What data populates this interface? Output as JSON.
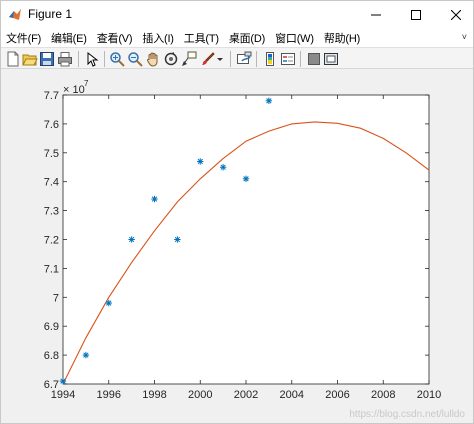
{
  "window": {
    "title": "Figure 1",
    "minimize_glyph": "—",
    "maximize_glyph": "☐",
    "close_glyph": "✕"
  },
  "menu": {
    "items": [
      {
        "label": "文件(F)"
      },
      {
        "label": "编辑(E)"
      },
      {
        "label": "查看(V)"
      },
      {
        "label": "插入(I)"
      },
      {
        "label": "工具(T)"
      },
      {
        "label": "桌面(D)"
      },
      {
        "label": "窗口(W)"
      },
      {
        "label": "帮助(H)"
      }
    ],
    "expand_glyph": "˅"
  },
  "toolbar": {
    "buttons": [
      "new-figure-icon",
      "open-file-icon",
      "save-icon",
      "print-icon",
      "edit-plot-arrow-icon",
      "zoom-in-icon",
      "zoom-out-icon",
      "pan-hand-icon",
      "rotate-3d-icon",
      "data-cursor-icon",
      "brush-icon",
      "brush-dropdown-icon",
      "link-plot-icon",
      "insert-colorbar-icon",
      "insert-legend-icon",
      "hide-plot-tools-icon",
      "show-plot-tools-icon"
    ]
  },
  "colors": {
    "window_bg": "#f0f0f0",
    "axes_bg": "#ffffff",
    "marker": "#0072bd",
    "fit_line": "#d95319",
    "axis": "#262626"
  },
  "watermark": "https://blog.csdn.net/lulldo",
  "chart_data": {
    "type": "scatter",
    "title": "",
    "xlabel": "",
    "ylabel": "",
    "xlim": [
      1994,
      2010
    ],
    "ylim": [
      6.7,
      7.7
    ],
    "y_exponent_label": "× 10",
    "y_exponent_power": "7",
    "xticks": [
      1994,
      1996,
      1998,
      2000,
      2002,
      2004,
      2006,
      2008,
      2010
    ],
    "yticks": [
      6.7,
      6.8,
      6.9,
      7.0,
      7.1,
      7.2,
      7.3,
      7.4,
      7.5,
      7.6,
      7.7
    ],
    "xtick_labels": [
      "1994",
      "1996",
      "1998",
      "2000",
      "2002",
      "2004",
      "2006",
      "2008",
      "2010"
    ],
    "ytick_labels": [
      "6.7",
      "6.8",
      "6.9",
      "7",
      "7.1",
      "7.2",
      "7.3",
      "7.4",
      "7.5",
      "7.6",
      "7.7"
    ],
    "grid": false,
    "series": [
      {
        "kind": "scatter",
        "marker": "*",
        "x": [
          1994,
          1995,
          1996,
          1997,
          1998,
          1999,
          2000,
          2001,
          2002,
          2003
        ],
        "y": [
          6.71,
          6.8,
          6.98,
          7.2,
          7.34,
          7.2,
          7.47,
          7.45,
          7.41,
          7.68
        ]
      },
      {
        "kind": "line",
        "x": [
          1994,
          1995,
          1996,
          1997,
          1998,
          1999,
          2000,
          2001,
          2002,
          2003,
          2004,
          2005,
          2006,
          2007,
          2008,
          2009,
          2010
        ],
        "y": [
          6.7,
          6.86,
          7.0,
          7.12,
          7.23,
          7.33,
          7.41,
          7.48,
          7.54,
          7.575,
          7.6,
          7.607,
          7.602,
          7.585,
          7.55,
          7.5,
          7.44
        ]
      }
    ]
  }
}
